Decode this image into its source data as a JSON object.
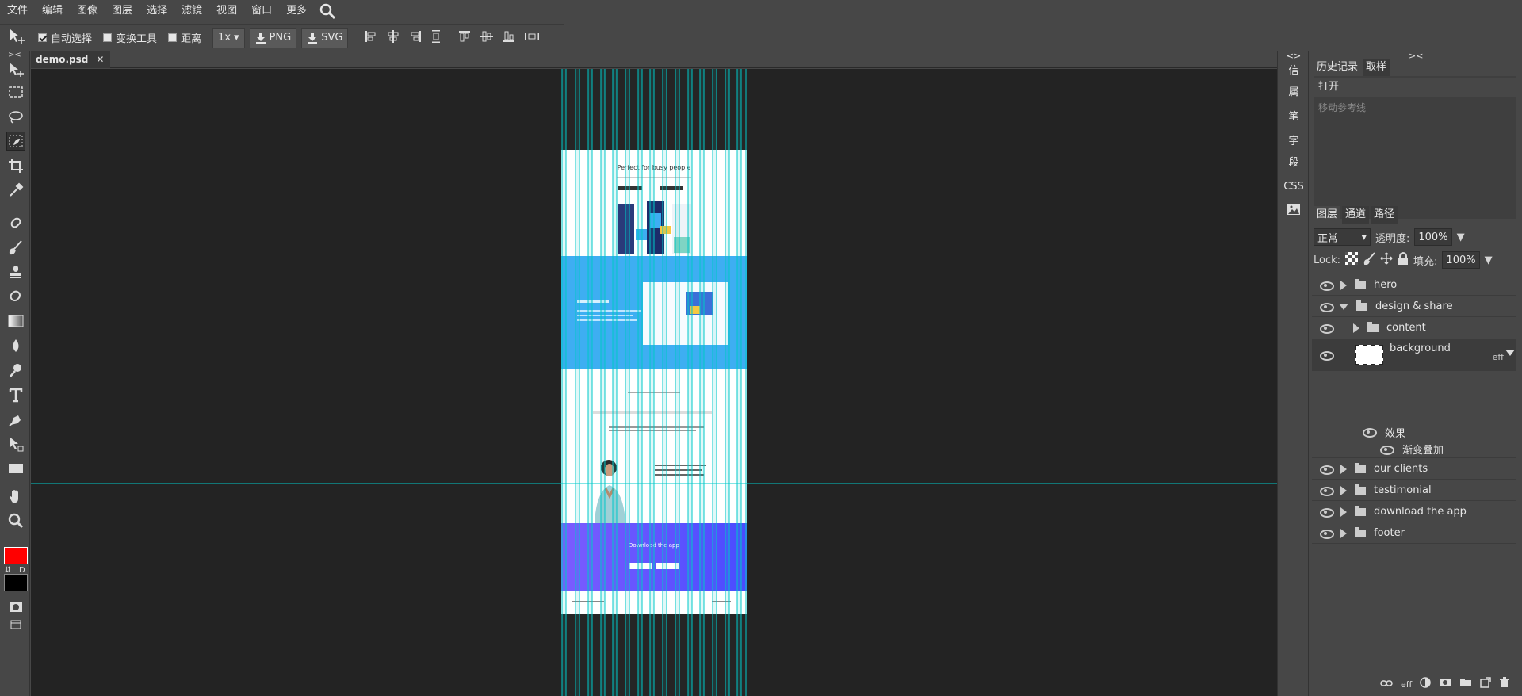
{
  "menu": [
    "文件",
    "编辑",
    "图像",
    "图层",
    "选择",
    "滤镜",
    "视图",
    "窗口",
    "更多"
  ],
  "options": {
    "auto_select": "自动选择",
    "transform_tools": "变换工具",
    "distance": "距离",
    "zoom": "1x",
    "png": "PNG",
    "svg": "SVG"
  },
  "document_tab": {
    "name": "demo.psd",
    "close": "✕"
  },
  "colors": {
    "foreground": "#ff0000",
    "background": "#000000",
    "guide": "#00c8c8",
    "accent_blue": "#3eaef2",
    "accent_purple": "#6a4cff"
  },
  "narrow_panel": {
    "toggle": "<>",
    "items": [
      "信",
      "属",
      "笔",
      "字",
      "段",
      "CSS"
    ]
  },
  "history_panel": {
    "toggle": "><",
    "tabs": [
      "历史记录",
      "取样"
    ],
    "items": [
      "打开",
      "移动参考线"
    ]
  },
  "layers_panel": {
    "tabs": [
      "图层",
      "通道",
      "路径"
    ],
    "blend_mode": "正常",
    "opacity_label": "透明度:",
    "opacity": "100%",
    "lock_label": "Lock:",
    "fill_label": "填充:",
    "fill": "100%",
    "layers": [
      {
        "name": "hero",
        "expanded": false
      },
      {
        "name": "design & share",
        "expanded": true
      },
      {
        "name": "content",
        "expanded": false
      },
      {
        "name": "background",
        "effect_tag": "eff"
      },
      {
        "name": "效果"
      },
      {
        "name": "渐变叠加"
      },
      {
        "name": "our clients",
        "expanded": false
      },
      {
        "name": "testimonial",
        "expanded": false
      },
      {
        "name": "download the app",
        "expanded": false
      },
      {
        "name": "footer",
        "expanded": false
      }
    ],
    "footer_eff": "eff"
  },
  "canvas": {
    "hero_title": "Perfect for busy people",
    "cta_title": "Download the app"
  }
}
